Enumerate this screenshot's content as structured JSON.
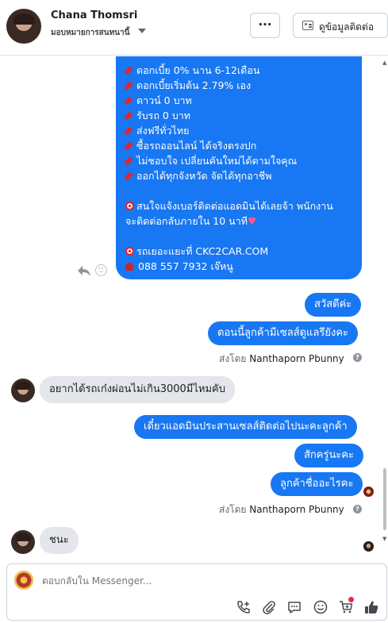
{
  "header": {
    "contact_name": "Chana Thomsri",
    "assign_label": "มอบหมายการสนทนานี้",
    "more_label": "···",
    "contact_info_label": "ดูข้อมูลติดต่อ"
  },
  "promo_lines": [
    "ดอกเบี้ย 0% นาน 6-12เดือน",
    "ดอกเบี้ยเริ่มต้น 2.79% เอง",
    "ดาวน์ 0 บาท",
    "รับรถ 0 บาท",
    "ส่งฟรีทั่วไทย",
    "ซื้อรถออนไลน์ ได้จริงตรงปก",
    "ไม่ชอบใจ เปลี่ยนคันใหม่ได้ตามใจคุณ",
    "ออกได้ทุกจังหวัด จัดได้ทุกอาชีพ"
  ],
  "promo_cta_1": "สนใจแจ้งเบอร์ติดต่อแอดมินได้เลยจ้า พนักงาน",
  "promo_cta_2": "จะติดต่อกลับภายใน 10 นาที",
  "promo_site": "รถเยอะแยะที่ CKC2CAR.COM",
  "promo_phone": "088 557 7932 เจ๊หนู",
  "messages": {
    "out1": "สวัสดีค่ะ",
    "out2": "ตอนนี้ลูกค้ามีเซลส์ดูแลรึยังคะ",
    "sent_by_label": "ส่งโดย",
    "sender_name": "Nanthaporn Pbunny",
    "in1": "อยากได้รถเก๋งผ่อนไม่เกิน3000มีไหมคับ",
    "out3": "เดี๋ยวแอดมินประสานเซลส์ติดต่อไปนะคะลูกค้า",
    "out4": "สักครู่นะคะ",
    "out5": "ลูกค้าชื่ออะไรคะ",
    "in2": "ชนะ"
  },
  "composer": {
    "placeholder": "ตอบกลับใน Messenger..."
  },
  "colors": {
    "outgoing_bubble": "#1877f2",
    "incoming_bubble": "#e4e6eb",
    "notification_dot": "#f02849"
  },
  "icons": [
    "more-icon",
    "contact-card-icon",
    "reply-icon",
    "reaction-icon",
    "info-icon",
    "add-call-icon",
    "attach-icon",
    "saved-reply-icon",
    "emoji-icon",
    "cart-icon",
    "like-icon"
  ]
}
